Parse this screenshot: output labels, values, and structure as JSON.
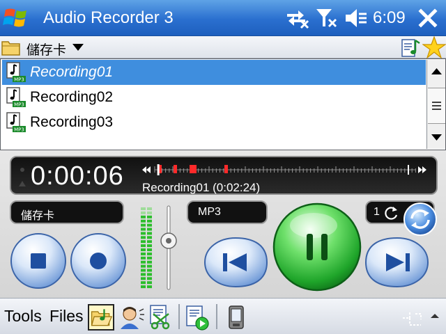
{
  "titlebar": {
    "title": "Audio Recorder 3",
    "clock": "6:09",
    "status_icons": [
      "sync-disconnected-icon",
      "signal-off-icon",
      "speaker-muted-icon"
    ],
    "close_icon": "close-icon"
  },
  "folderbar": {
    "location": "儲存卡",
    "icons": [
      "folder-icon",
      "caret-down-icon",
      "doc-music-icon",
      "star-icon"
    ]
  },
  "filelist": {
    "items": [
      {
        "label": "Recording01",
        "badge": "MP3",
        "selected": true
      },
      {
        "label": "Recording02",
        "badge": "MP3",
        "selected": false
      },
      {
        "label": "Recording03",
        "badge": "MP3",
        "selected": false
      }
    ]
  },
  "player": {
    "elapsed": "0:00:06",
    "track_info": "Recording01 (0:02:24)",
    "storage": "儲存卡",
    "format": "MP3",
    "repeat_count": "1",
    "progress_fraction": 0.01
  },
  "menubar": {
    "left": "Tools",
    "right": "Files",
    "toolbar_icons": [
      "open-folder-icon",
      "speaker-person-icon",
      "cut-edit-icon",
      "playlist-play-icon",
      "device-icon"
    ]
  },
  "colors": {
    "title_bar": "#2a6fcf",
    "selection": "#3f8ede",
    "pause_button": "#2fbf3a",
    "lcd_background": "#111111"
  }
}
